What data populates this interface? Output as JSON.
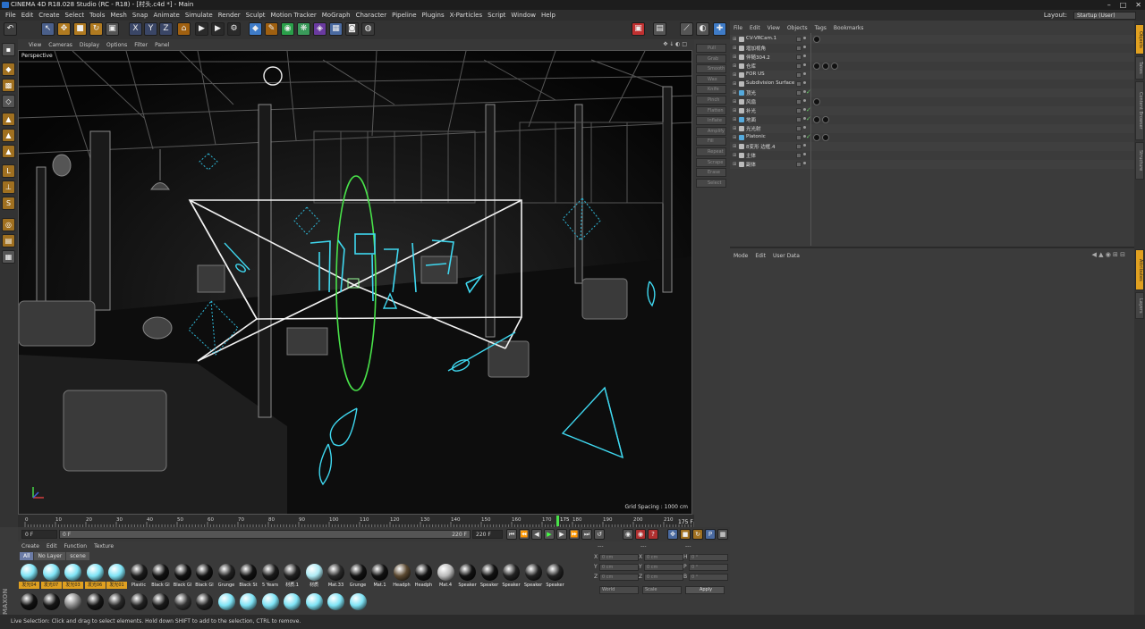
{
  "window": {
    "title": "CINEMA 4D R18.028 Studio (RC - R18) - [村头.c4d *] - Main"
  },
  "menu": [
    "File",
    "Edit",
    "Create",
    "Select",
    "Tools",
    "Mesh",
    "Snap",
    "Animate",
    "Simulate",
    "Render",
    "Sculpt",
    "Motion Tracker",
    "MoGraph",
    "Character",
    "Pipeline",
    "Plugins",
    "X-Particles",
    "Script",
    "Window",
    "Help"
  ],
  "layout": {
    "label": "Layout:",
    "value": "Startup (User)"
  },
  "viewport": {
    "menu": [
      "View",
      "Cameras",
      "Display",
      "Options",
      "Filter",
      "Panel"
    ],
    "label": "Perspective",
    "grid_spacing": "Grid Spacing : 1000 cm"
  },
  "sculpt_tools": [
    "Pull",
    "Grab",
    "Smooth",
    "Wax",
    "Knife",
    "Pinch",
    "Flatten",
    "Inflate",
    "Amplify",
    "Fill",
    "Repeat",
    "Scrape",
    "Erase",
    "Select"
  ],
  "timeline": {
    "ticks": [
      "0",
      "10",
      "20",
      "30",
      "40",
      "50",
      "60",
      "70",
      "80",
      "90",
      "100",
      "110",
      "120",
      "130",
      "140",
      "150",
      "160",
      "170",
      "180",
      "190",
      "200",
      "210",
      "220"
    ],
    "current_frame": "175",
    "end_label": "175 F",
    "start_field": "0 F",
    "start_field2": "0 F",
    "end_field": "220 F",
    "end_field2": "220 F"
  },
  "material_manager": {
    "menu": [
      "Create",
      "Edit",
      "Function",
      "Texture"
    ],
    "tabs": [
      "All",
      "No Layer",
      "scene"
    ],
    "row1": [
      {
        "label": "发光04",
        "color": "#7fe3f5",
        "sel": true
      },
      {
        "label": "发光07",
        "color": "#7fe3f5",
        "sel": true
      },
      {
        "label": "发光03",
        "color": "#7fe3f5",
        "sel": true
      },
      {
        "label": "发光06",
        "color": "#7fe3f5",
        "sel": true
      },
      {
        "label": "发光01",
        "color": "#7fe3f5",
        "sel": true
      },
      {
        "label": "Plastic",
        "color": "#1a1a1a",
        "sel": false
      },
      {
        "label": "Black Gl",
        "color": "#111",
        "sel": false
      },
      {
        "label": "Black Gl",
        "color": "#111",
        "sel": false
      },
      {
        "label": "Black Gl",
        "color": "#111",
        "sel": false
      },
      {
        "label": "Grunge",
        "color": "#222",
        "sel": false
      },
      {
        "label": "Black St",
        "color": "#111",
        "sel": false
      },
      {
        "label": "5 Years",
        "color": "#1a1a1a",
        "sel": false
      },
      {
        "label": "材质.1",
        "color": "#202020",
        "sel": false
      },
      {
        "label": "材质",
        "color": "#aeeaf4",
        "sel": false
      },
      {
        "label": "Mat.33",
        "color": "#2a2a2a",
        "sel": false
      },
      {
        "label": "Grunge",
        "color": "#111",
        "sel": false
      },
      {
        "label": "Mat.1",
        "color": "#111",
        "sel": false
      },
      {
        "label": "Headph",
        "color": "#5a4830",
        "sel": false
      },
      {
        "label": "Headph",
        "color": "#111",
        "sel": false
      },
      {
        "label": "Mat.4",
        "color": "#bbbbbb",
        "sel": false
      },
      {
        "label": "Speaker",
        "color": "#111",
        "sel": false
      },
      {
        "label": "Speaker",
        "color": "#111",
        "sel": false
      },
      {
        "label": "Speaker",
        "color": "#222",
        "sel": false
      },
      {
        "label": "Speaker",
        "color": "#222",
        "sel": false
      },
      {
        "label": "Speaker",
        "color": "#222",
        "sel": false
      }
    ],
    "row2_colors": [
      "#111",
      "#161616",
      "#888",
      "#161616",
      "#2a2a2a",
      "#222",
      "#1a1a1a",
      "#333",
      "#222",
      "#7fe3f5",
      "#7fe3f5",
      "#7fe3f5",
      "#7fe3f5",
      "#7fe3f5",
      "#7fe3f5",
      "#7fe3f5"
    ]
  },
  "coords": {
    "labels": [
      "X",
      "Y",
      "Z"
    ],
    "rot_labels": [
      "H",
      "P",
      "B"
    ],
    "pos": [
      "0 cm",
      "0 cm",
      "0 cm"
    ],
    "size": [
      "0 cm",
      "0 cm",
      "0 cm"
    ],
    "rot": [
      "0 °",
      "0 °",
      "0 °"
    ],
    "world": "World",
    "scale": "Scale",
    "apply": "Apply",
    "header": [
      "---",
      "---",
      "---"
    ]
  },
  "object_manager": {
    "menu": [
      "File",
      "Edit",
      "View",
      "Objects",
      "Tags",
      "Bookmarks"
    ],
    "objects": [
      "CV-VRCam.1",
      "增加视角",
      "伴随304.2",
      "仓库",
      "FOR US",
      "Subdivision Surface",
      "顶光",
      "风扇",
      "补光",
      "地面",
      "光光射",
      "Platonic",
      "8变形 边框.4",
      "主体",
      "副体"
    ]
  },
  "attributes": {
    "menu": [
      "Mode",
      "Edit",
      "User Data"
    ]
  },
  "side_tabs": [
    "Objects",
    "Takes",
    "Content Browser",
    "Structure"
  ],
  "side_tabs2": [
    "Attributes",
    "Layers"
  ],
  "status": "Live Selection: Click and drag to select elements. Hold down SHIFT to add to the selection, CTRL to remove.",
  "colors": {
    "accent": "#e0a020",
    "selection": "#6b7ba6",
    "glow": "#3fd8f0",
    "green": "#49e24a"
  }
}
